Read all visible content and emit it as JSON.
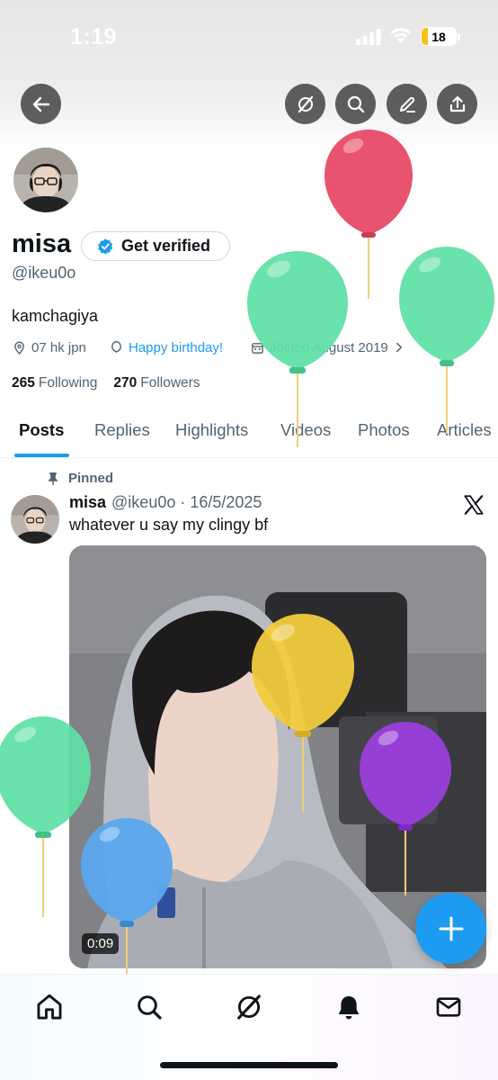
{
  "status_bar": {
    "time": "1:19",
    "battery": "18",
    "battery_level": 0.18
  },
  "header": {
    "back_icon": "arrow-left-icon",
    "actions": [
      "grok-icon",
      "search-icon",
      "edit-icon",
      "share-icon"
    ]
  },
  "profile": {
    "display_name": "misa",
    "verify_label": "Get verified",
    "handle": "@ikeu0o",
    "bio": "kamchagiya",
    "location": "07 hk jpn",
    "birthday": "Happy birthday!",
    "joined": "Joined August 2019",
    "following_count": "265",
    "following_label": "Following",
    "followers_count": "270",
    "followers_label": "Followers"
  },
  "tabs": [
    {
      "label": "Posts",
      "active": true
    },
    {
      "label": "Replies"
    },
    {
      "label": "Highlights"
    },
    {
      "label": "Videos"
    },
    {
      "label": "Photos"
    },
    {
      "label": "Articles"
    }
  ],
  "post": {
    "pinned_label": "Pinned",
    "author": "misa",
    "meta": "@ikeu0o · 16/5/2025",
    "text": "whatever u say my clingy bf",
    "video_duration": "0:09"
  },
  "balloons": [
    {
      "color": "#e8536f"
    },
    {
      "color": "#5fe0a5"
    },
    {
      "color": "#5fe0a5"
    },
    {
      "color": "#f2cc3d"
    },
    {
      "color": "#5fe0a5"
    },
    {
      "color": "#9b3ee0"
    },
    {
      "color": "#5aa6ee"
    }
  ],
  "bottom_nav": [
    "home-icon",
    "search-icon",
    "grok-icon",
    "notifications-icon",
    "messages-icon"
  ],
  "colors": {
    "accent": "#1d9bf0",
    "text": "#0f1419",
    "muted": "#536471"
  }
}
